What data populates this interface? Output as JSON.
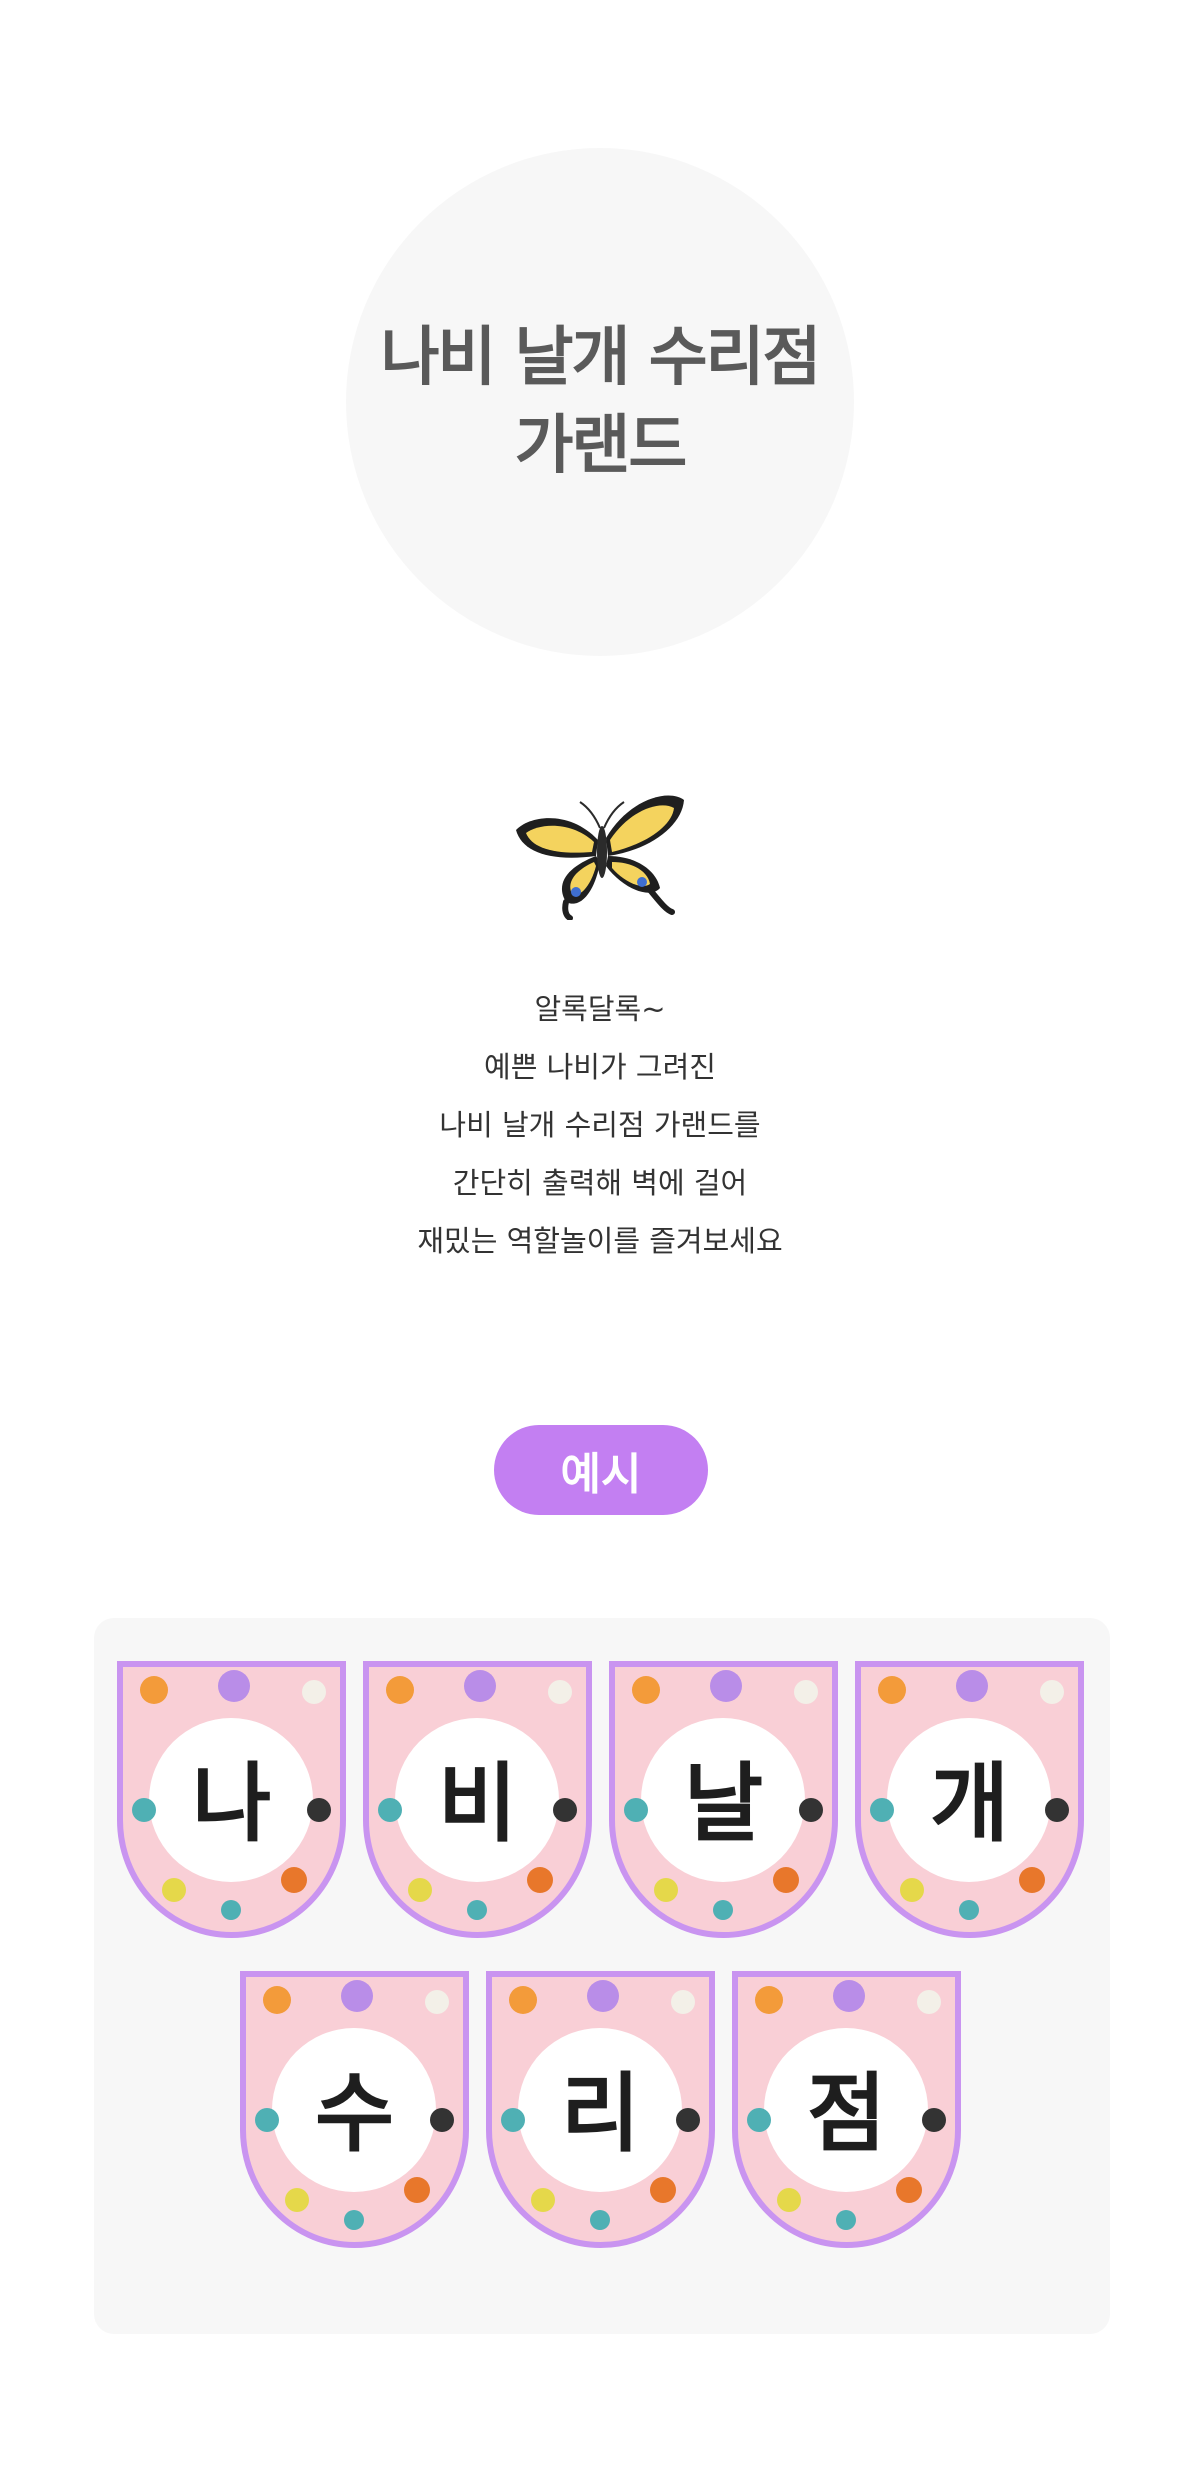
{
  "hero": {
    "title_line1": "나비 날개 수리점",
    "title_line2": "가랜드"
  },
  "description": {
    "lines": [
      "알록달록~",
      "예쁜 나비가 그려진",
      "나비 날개 수리점 가랜드를",
      "간단히 출력해 벽에 걸어",
      "재밌는 역할놀이를 즐겨보세요"
    ]
  },
  "example": {
    "badge_label": "예시",
    "row1": [
      "나",
      "비",
      "날",
      "개"
    ],
    "row2": [
      "수",
      "리",
      "점"
    ]
  },
  "colors": {
    "accent": "#c37ff2",
    "pennant_fill": "#f9cfd6",
    "pennant_border": "#c994f0",
    "panel_bg": "#f7f7f7",
    "hero_bg": "#f7f7f7"
  },
  "icons": [
    "butterfly-icon"
  ]
}
